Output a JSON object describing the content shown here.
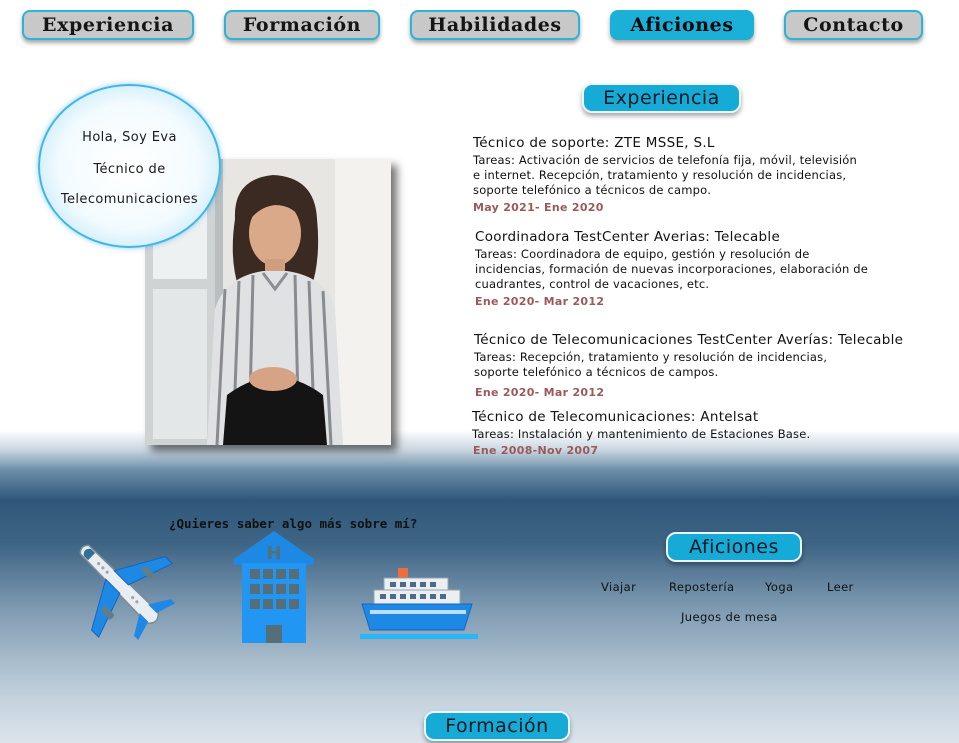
{
  "nav": {
    "items": [
      {
        "label": "Experiencia"
      },
      {
        "label": "Formación"
      },
      {
        "label": "Habilidades"
      },
      {
        "label": "Aficiones",
        "active": true
      },
      {
        "label": "Contacto"
      }
    ]
  },
  "intro": {
    "greeting": "Hola, Soy Eva",
    "role_line1": "Técnico de",
    "role_line2": "Telecomunicaciones"
  },
  "experience": {
    "heading": "Experiencia",
    "jobs": [
      {
        "title": "Técnico de soporte: ZTE MSSE, S.L",
        "tasks": "Tareas: Activación de servicios de telefonía fija, móvil, televisión\ne internet. Recepción, tratamiento y resolución de incidencias,\nsoporte telefónico a técnicos de campo.",
        "dates": "May 2021- Ene 2020"
      },
      {
        "title": "Coordinadora TestCenter Averias: Telecable",
        "tasks": "Tareas: Coordinadora de equipo, gestión y resolución de\nincidencias, formación de nuevas incorporaciones, elaboración de\ncuadrantes, control de vacaciones, etc.",
        "dates": "Ene 2020- Mar 2012"
      },
      {
        "title": "Técnico de Telecomunicaciones TestCenter Averías: Telecable",
        "tasks": "Tareas: Recepción, tratamiento y resolución de incidencias,\nsoporte telefónico a técnicos de campos.",
        "dates": "Ene 2020- Mar 2012"
      },
      {
        "title": "Técnico de Telecomunicaciones: Antelsat",
        "tasks": "Tareas: Instalación y mantenimiento de Estaciones Base.",
        "dates": "Ene 2008-Nov 2007"
      }
    ]
  },
  "more": {
    "question": "¿Quieres saber algo más sobre mí?",
    "icons": [
      "airplane-icon",
      "hotel-icon",
      "cruise-ship-icon"
    ]
  },
  "hobbies": {
    "heading": "Aficiones",
    "items": [
      "Viajar",
      "Repostería",
      "Yoga",
      "Leer",
      "Juegos de mesa"
    ]
  },
  "education": {
    "heading": "Formación"
  },
  "colors": {
    "accent": "#16aad6",
    "nav_bg": "#c8c8c8",
    "date": "#9a5a5a",
    "icon_blue": "#1e88e5"
  }
}
